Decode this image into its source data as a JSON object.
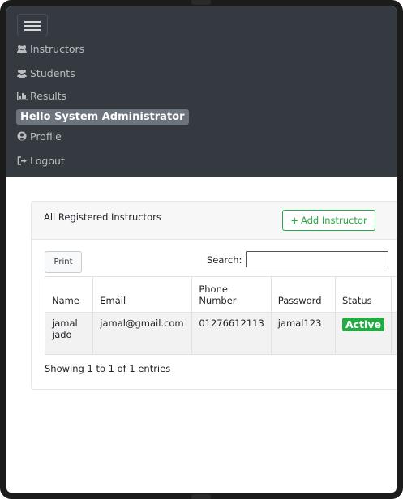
{
  "nav": {
    "items": [
      {
        "icon": "users-icon",
        "label": "Instructors"
      },
      {
        "icon": "users-icon",
        "label": "Students"
      },
      {
        "icon": "bar-chart-icon",
        "label": "Results"
      }
    ],
    "greeting": "Hello System Administrator",
    "profile_label": "Profile",
    "logout_label": "Logout"
  },
  "card": {
    "title": "All Registered Instructors",
    "add_button_label": "Add Instructor",
    "print_label": "Print",
    "search_label": "Search:",
    "search_value": "",
    "columns": [
      "Name",
      "Email",
      "Phone Number",
      "Password",
      "Status"
    ],
    "rows": [
      {
        "name": "jamal jado",
        "email": "jamal@gmail.com",
        "phone": "01276612113",
        "password": "jamal123",
        "status": "Active"
      }
    ],
    "info": "Showing 1 to 1 of 1 entries"
  },
  "colors": {
    "navbar": "#343a40",
    "success": "#28a745",
    "danger": "#dc3545",
    "badge": "#6c757d"
  }
}
